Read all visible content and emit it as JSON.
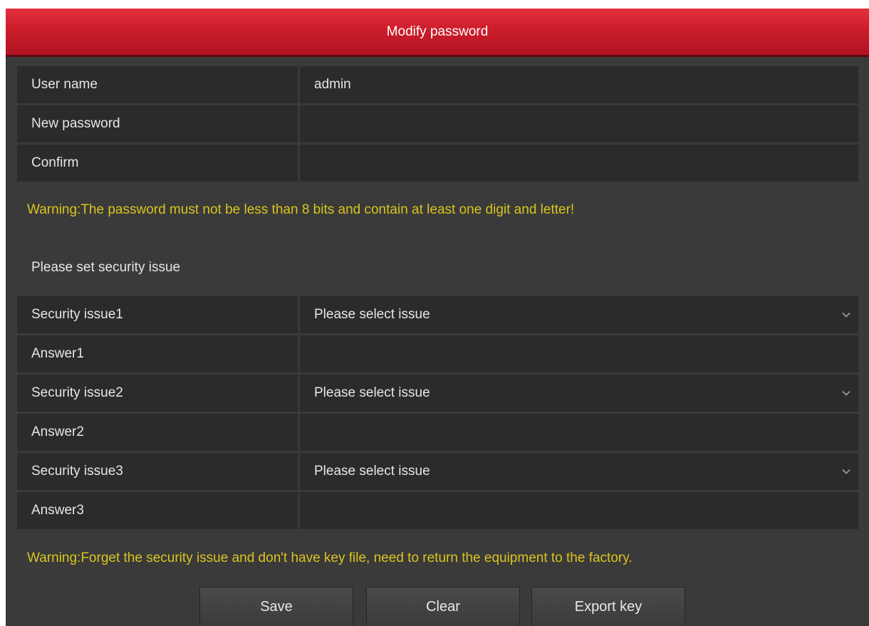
{
  "dialog": {
    "title": "Modify password"
  },
  "account": {
    "username_label": "User name",
    "username_value": "admin",
    "new_password_label": "New password",
    "new_password_value": "",
    "confirm_label": "Confirm",
    "confirm_value": ""
  },
  "password_warning": "Warning:The password must not be less than 8 bits and contain at least one digit and letter!",
  "security_section_label": "Please set security issue",
  "security": [
    {
      "issue_label": "Security issue1",
      "issue_value": "Please select issue",
      "answer_label": "Answer1",
      "answer_value": ""
    },
    {
      "issue_label": "Security issue2",
      "issue_value": "Please select issue",
      "answer_label": "Answer2",
      "answer_value": ""
    },
    {
      "issue_label": "Security issue3",
      "issue_value": "Please select issue",
      "answer_label": "Answer3",
      "answer_value": ""
    }
  ],
  "factory_warning": "Warning:Forget the security issue and don't have key file, need to return the equipment to the factory.",
  "buttons": {
    "save": "Save",
    "clear": "Clear",
    "export_key": "Export key"
  },
  "colors": {
    "header": "#cc1d2b",
    "warning_text": "#d8c41e",
    "panel_bg": "#3a3a3a",
    "cell_bg": "#2b2b2b"
  },
  "icons": {
    "dropdown": "chevron-down-icon"
  }
}
